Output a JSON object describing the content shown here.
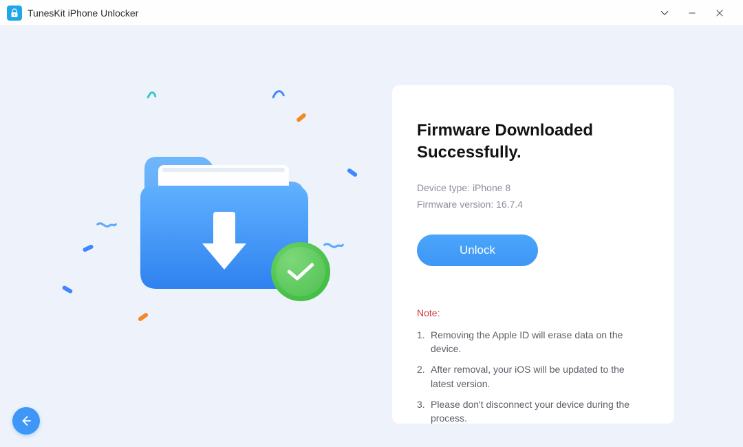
{
  "titlebar": {
    "app_name": "TunesKit iPhone Unlocker"
  },
  "main": {
    "heading": "Firmware Downloaded Successfully.",
    "device_type_label": "Device type:",
    "device_type_value": "iPhone 8",
    "firmware_label": "Firmware version:",
    "firmware_value": "16.7.4",
    "unlock_label": "Unlock",
    "note_heading": "Note:",
    "notes": [
      "Removing the Apple ID will erase data on the device.",
      "After removal, your iOS will be updated to the latest version.",
      "Please don't disconnect your device during the process."
    ]
  },
  "colors": {
    "accent": "#3e96f6",
    "success": "#45bf46",
    "danger": "#d23a3a"
  }
}
